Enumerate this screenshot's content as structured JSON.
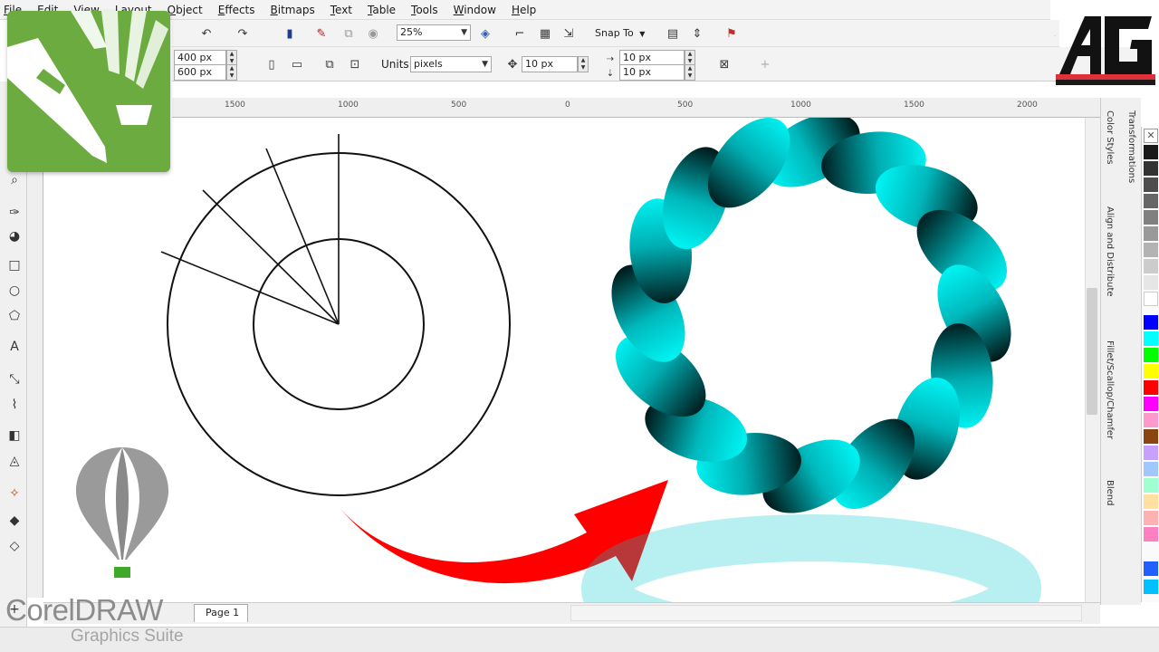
{
  "menu": [
    "File",
    "Edit",
    "View",
    "Layout",
    "Object",
    "Effects",
    "Bitmaps",
    "Text",
    "Table",
    "Tools",
    "Window",
    "Help"
  ],
  "toolbar": {
    "zoom_value": "25%",
    "snap_label": "Snap To"
  },
  "property_bar": {
    "width_value": "400 px",
    "height_value": "600 px",
    "units_label": "Units:",
    "units_value": "pixels",
    "nudge_value": "10 px",
    "dup_x_value": "10 px",
    "dup_y_value": "10 px"
  },
  "ruler_labels": [
    "1500",
    "1000",
    "500",
    "0",
    "500",
    "1000",
    "1500",
    "2000"
  ],
  "page_tab": "Page 1",
  "dockers": [
    "Color Styles",
    "Align and Distribute",
    "Fillet/Scallop/Chamfer",
    "Blend"
  ],
  "docker_secondary": "Transformations",
  "branding": {
    "product": "CorelDRAW",
    "suite": "Graphics Suite",
    "channel_logo": "AG"
  },
  "palette": [
    "#ffffff",
    "#1a1a1a",
    "#333333",
    "#4d4d4d",
    "#666666",
    "#808080",
    "#999999",
    "#b3b3b3",
    "#cccccc",
    "#e6e6e6",
    "#ffffff",
    "#0000ff",
    "#00ffff",
    "#00ff00",
    "#ffff00",
    "#ff0000",
    "#ff00ff",
    "#ff99cc",
    "#8b4513",
    "#c8a0ff",
    "#a0c8ff",
    "#a0ffd0",
    "#ffe0a0",
    "#ffb0b0",
    "#ff80c0",
    "#2060ff",
    "#00c0ff"
  ],
  "colors": {
    "accent_green": "#6bab3f",
    "ribbon_cyan": "#00e0e0",
    "arrow_red": "#ff0000"
  }
}
